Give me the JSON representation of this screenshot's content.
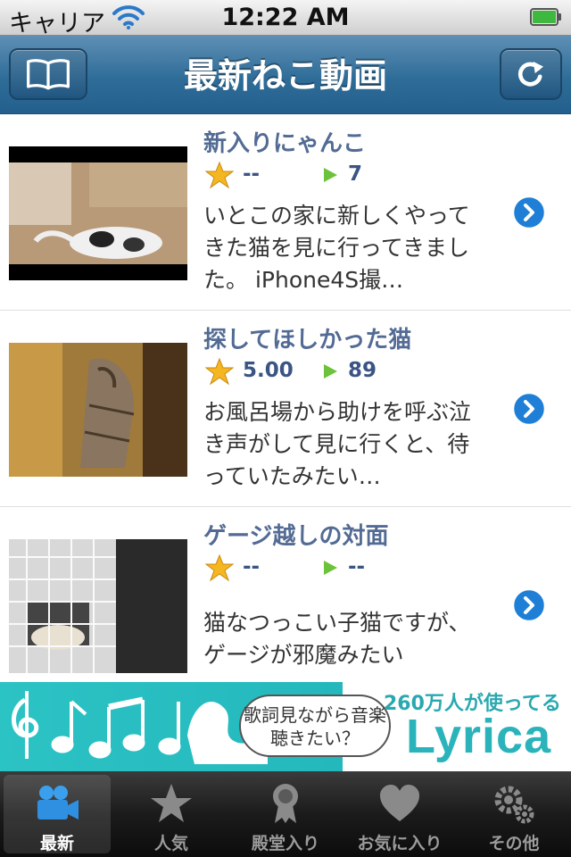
{
  "status_bar": {
    "carrier": "キャリア",
    "time": "12:22 AM"
  },
  "nav": {
    "title": "最新ねこ動画",
    "left_icon": "book-icon",
    "right_icon": "refresh-icon"
  },
  "videos": [
    {
      "title": "新入りにゃんこ",
      "rating": "--",
      "views": "7",
      "description": "いとこの家に新しくやってきた猫を見に行ってきました。 iPhone4S撮…"
    },
    {
      "title": "探してほしかった猫",
      "rating": "5.00",
      "views": "89",
      "description": "お風呂場から助けを呼ぶ泣き声がして見に行くと、待っていたみたい…"
    },
    {
      "title": "ゲージ越しの対面",
      "rating": "--",
      "views": "--",
      "description": "猫なつっこい子猫ですが、ゲージが邪魔みたい"
    }
  ],
  "ad": {
    "bubble": "歌詞見ながら音楽聴きたい？",
    "tagline": "260万人が使ってる",
    "brand": "Lyrica"
  },
  "tabs": [
    {
      "label": "最新",
      "icon": "video-camera-icon",
      "selected": true
    },
    {
      "label": "人気",
      "icon": "star-icon",
      "selected": false
    },
    {
      "label": "殿堂入り",
      "icon": "medal-icon",
      "selected": false
    },
    {
      "label": "お気に入り",
      "icon": "heart-icon",
      "selected": false
    },
    {
      "label": "その他",
      "icon": "gears-icon",
      "selected": false
    }
  ],
  "colors": {
    "nav_bar": "#2f6d99",
    "title_text": "#536b94",
    "accent": "#1f7fd6",
    "ad_teal": "#2cc3c5"
  }
}
